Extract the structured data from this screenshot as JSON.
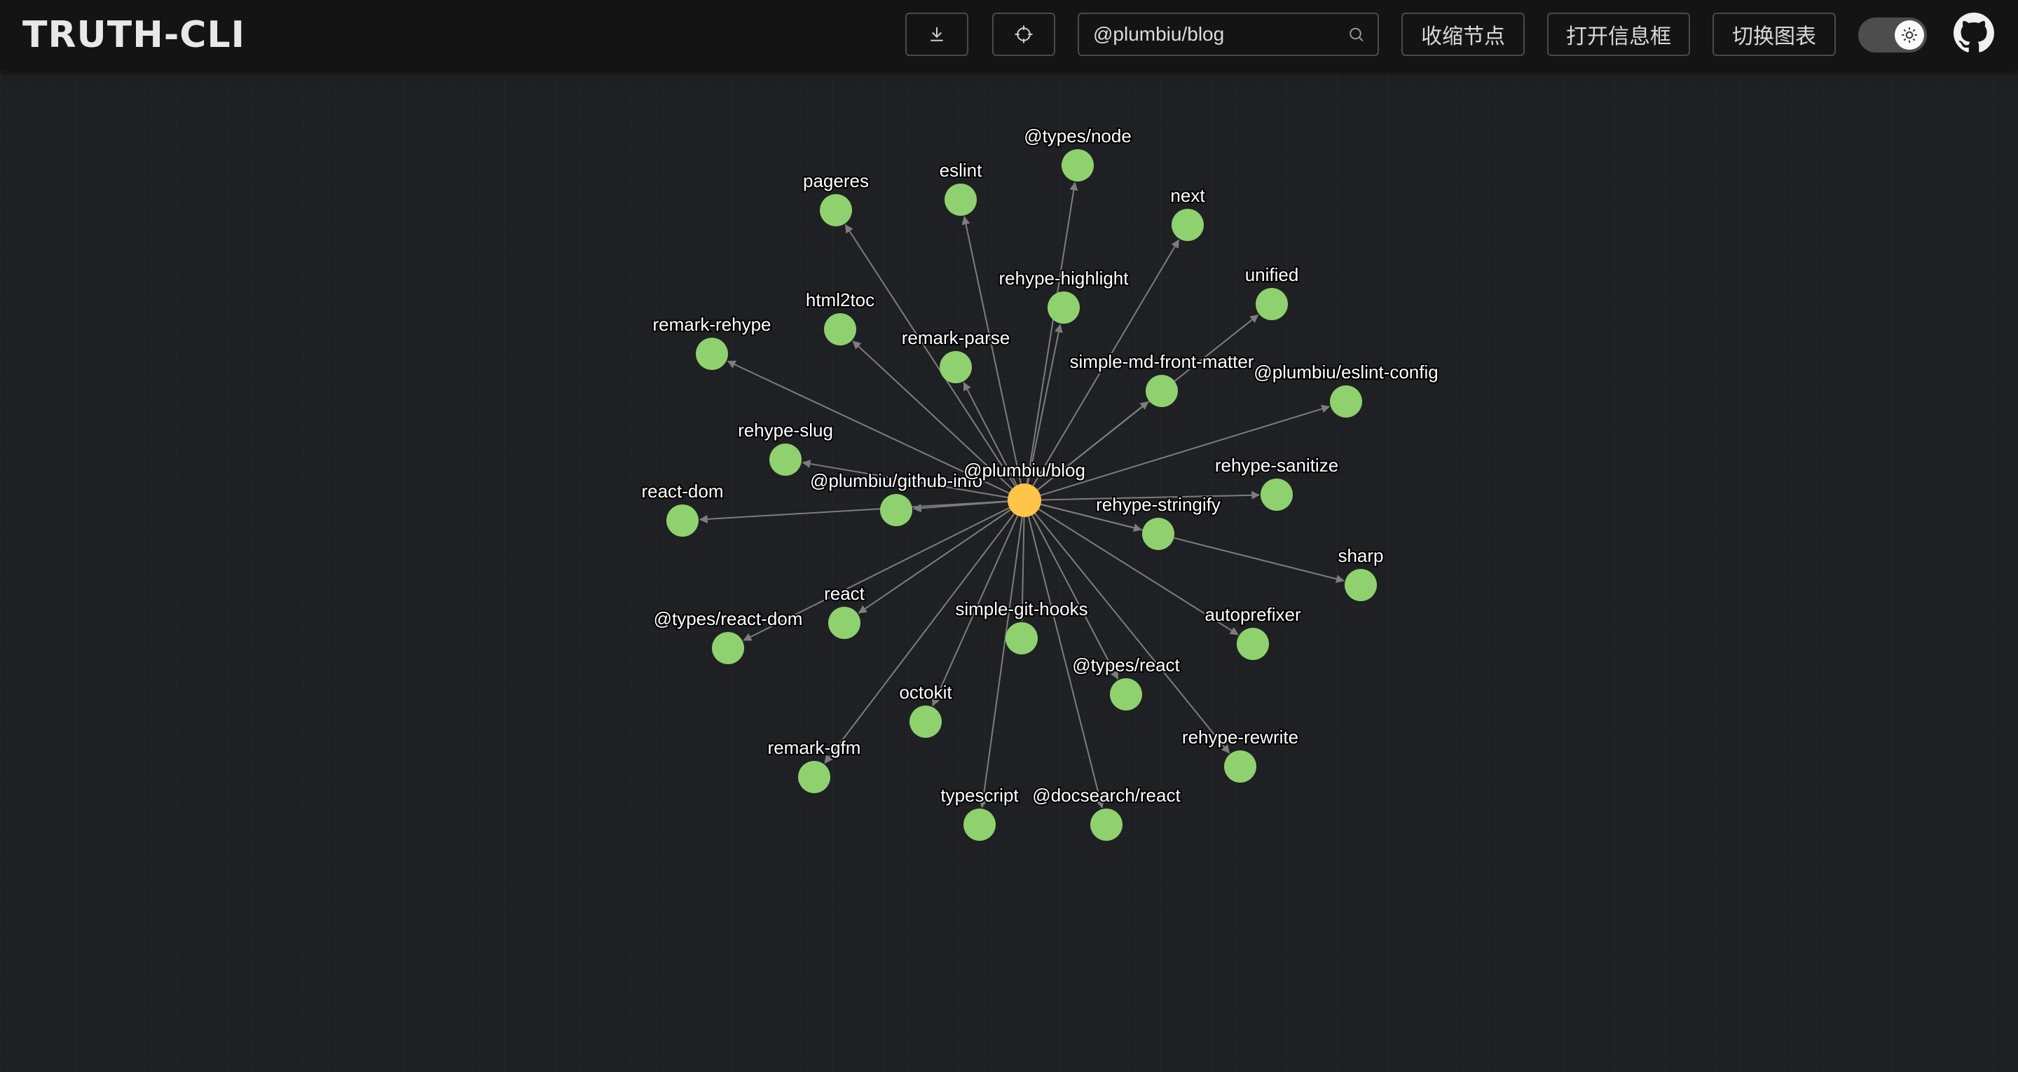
{
  "header": {
    "logo": "TRUTH-CLI",
    "download_icon": "download-icon",
    "locate_icon": "crosshair-icon",
    "search": {
      "value": "@plumbiu/blog",
      "placeholder": "",
      "icon": "search-icon"
    },
    "collapse_label": "收缩节点",
    "info_label": "打开信息框",
    "switch_chart_label": "切换图表",
    "theme_toggle_icon": "sun-icon",
    "github_icon": "github-icon"
  },
  "colors": {
    "root_node": "#ffc44a",
    "dep_node": "#8fd16e",
    "edge": "#7d7d7d"
  },
  "graph": {
    "root": "@plumbiu/blog",
    "dependencies": [
      "@types/node",
      "eslint",
      "pageres",
      "next",
      "rehype-highlight",
      "unified",
      "html2toc",
      "remark-rehype",
      "remark-parse",
      "simple-md-front-matter",
      "@plumbiu/eslint-config",
      "rehype-slug",
      "rehype-sanitize",
      "@plumbiu/github-info",
      "react-dom",
      "rehype-stringify",
      "sharp",
      "react",
      "@types/react-dom",
      "simple-git-hooks",
      "autoprefixer",
      "@types/react",
      "octokit",
      "rehype-rewrite",
      "remark-gfm",
      "typescript",
      "@docsearch/react"
    ]
  }
}
